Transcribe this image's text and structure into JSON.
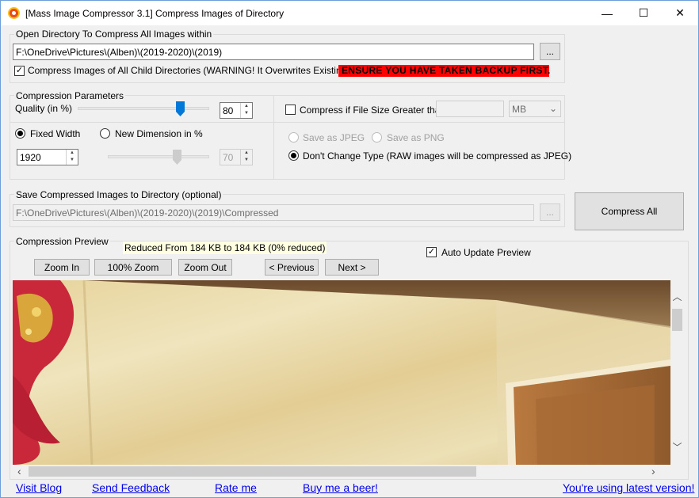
{
  "window": {
    "title": "[Mass Image Compressor 3.1] Compress Images of Directory",
    "minimize_glyph": "—",
    "maximize_glyph": "☐",
    "close_glyph": "✕"
  },
  "open_dir": {
    "group_label": "Open Directory To Compress All Images within",
    "path": "F:\\OneDrive\\Pictures\\(Alben)\\(2019-2020)\\(2019)",
    "browse_label": "...",
    "child_dirs_label": "Compress Images of All Child Directories (WARNING! It Overwrites Existing Images)",
    "child_dirs_checked": true,
    "warning": "ENSURE YOU HAVE TAKEN BACKUP FIRST."
  },
  "params": {
    "group_label": "Compression Parameters",
    "quality_label": "Quality (in %)",
    "quality_value": "80",
    "quality_level": 80,
    "fixed_width_label": "Fixed Width",
    "new_dimension_label": "New Dimension in %",
    "width_value": "1920",
    "dimension_value": "70",
    "dimension_level": 70
  },
  "filesize": {
    "label": "Compress if File Size Greater than",
    "value": "",
    "unit": "MB",
    "checked": false
  },
  "format": {
    "jpeg_label": "Save as JPEG",
    "png_label": "Save as PNG",
    "keep_label": "Don't Change Type (RAW images will be compressed as JPEG)"
  },
  "save_dir": {
    "group_label": "Save Compressed Images to Directory (optional)",
    "path": "F:\\OneDrive\\Pictures\\(Alben)\\(2019-2020)\\(2019)\\Compressed",
    "browse_label": "..."
  },
  "compress_all_label": "Compress All",
  "preview": {
    "group_label": "Compression Preview",
    "reduced_text": "Reduced From 184 KB to 184 KB (0% reduced)",
    "zoom_in": "Zoom In",
    "zoom_100": "100% Zoom",
    "zoom_out": "Zoom Out",
    "previous": "< Previous",
    "next": "Next >",
    "auto_update_label": "Auto Update Preview",
    "auto_update_checked": true
  },
  "footer": {
    "visit_blog": "Visit Blog",
    "send_feedback": "Send Feedback",
    "rate_me": "Rate me",
    "buy_beer": "Buy me a beer!",
    "latest_version": "You're using latest version!"
  },
  "colors": {
    "warning_bg": "#ff0000",
    "link": "#0000ee",
    "slider_thumb": "#0078d7",
    "tooltip_bg": "#ffffe1"
  },
  "icons": {
    "app": "app-logo-icon",
    "check": "✓",
    "spin_up": "▲",
    "spin_down": "▼",
    "scroll_up": "︿",
    "scroll_down": "﹀",
    "scroll_left": "‹",
    "scroll_right": "›",
    "combo_arrow": "⌄"
  }
}
